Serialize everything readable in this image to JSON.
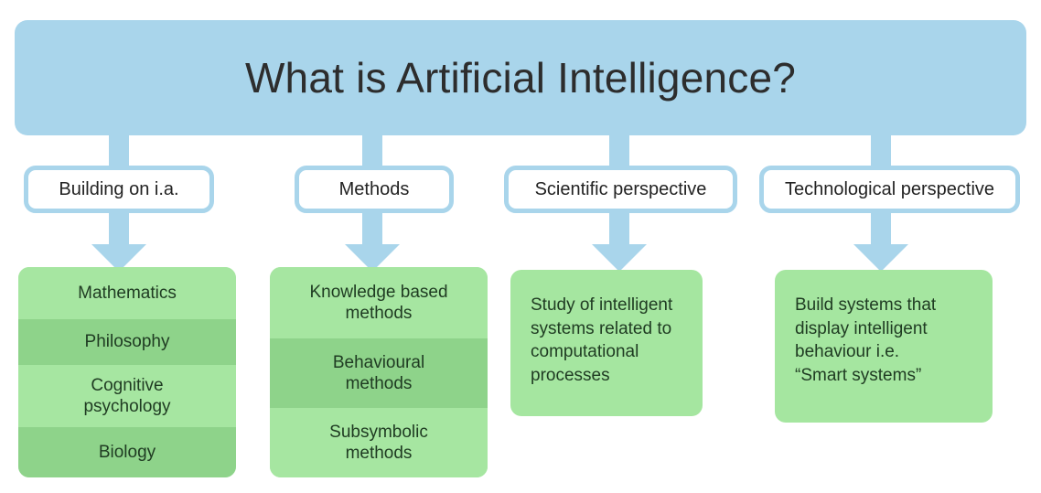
{
  "banner": {
    "title": "What is Artificial Intelligence?",
    "color": "#a9d5eb"
  },
  "branches": [
    {
      "label": "Building on i.a.",
      "items": [
        {
          "text": "Mathematics",
          "shade": "light"
        },
        {
          "text": "Philosophy",
          "shade": "dark"
        },
        {
          "text": "Cognitive\npsychology",
          "shade": "light"
        },
        {
          "text": "Biology",
          "shade": "dark"
        }
      ]
    },
    {
      "label": "Methods",
      "items": [
        {
          "text": "Knowledge based\nmethods",
          "shade": "light"
        },
        {
          "text": "Behavioural\nmethods",
          "shade": "dark"
        },
        {
          "text": "Subsymbolic\nmethods",
          "shade": "light"
        }
      ]
    },
    {
      "label": "Scientific perspective",
      "body": "Study of intelligent\nsystems related to\ncomputational\nprocesses"
    },
    {
      "label": "Technological perspective",
      "body": "Build systems that\ndisplay intelligent\nbehaviour i.e.\n“Smart systems”"
    }
  ],
  "colors": {
    "accent_blue": "#a9d5eb",
    "green_light": "#a6e6a1",
    "green_dark": "#8ed38a",
    "text_dark": "#232323",
    "text_green": "#1f3b22"
  }
}
